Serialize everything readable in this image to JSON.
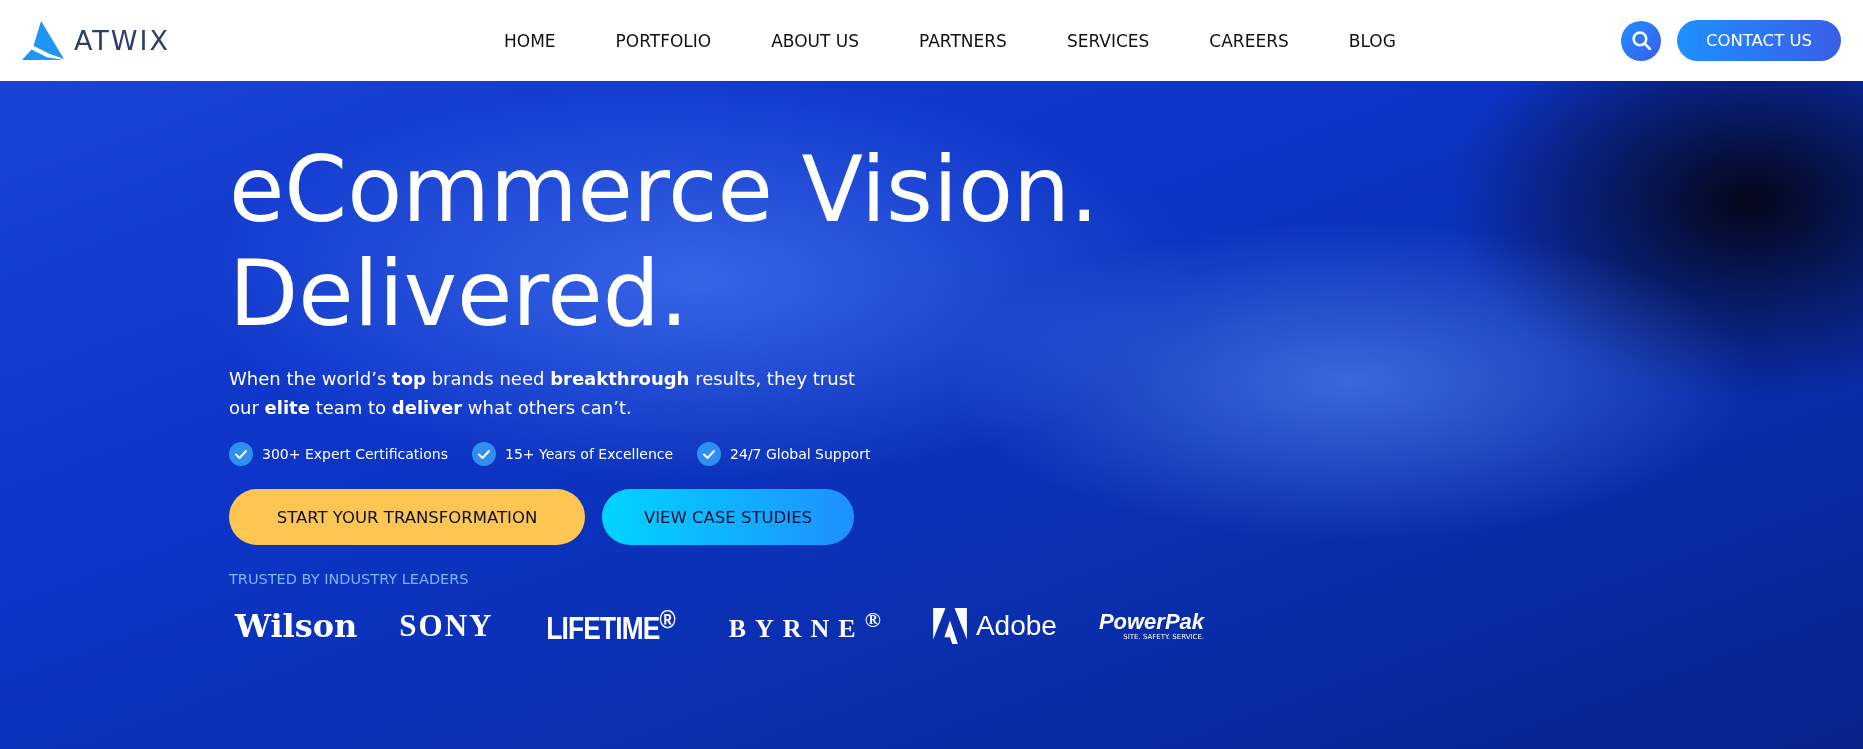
{
  "header": {
    "logo": "ATWIX",
    "nav": [
      {
        "label": "HOME"
      },
      {
        "label": "PORTFOLIO"
      },
      {
        "label": "ABOUT US"
      },
      {
        "label": "PARTNERS"
      },
      {
        "label": "SERVICES"
      },
      {
        "label": "CAREERS"
      },
      {
        "label": "BLOG"
      }
    ],
    "cta": "CONTACT US"
  },
  "hero": {
    "title_lines": [
      "eCommerce Vision.",
      "Delivered."
    ],
    "text": "When the world’s **top** brands need **breakthrough** results, they trust our **elite** team to **deliver** what others can’t.",
    "features": [
      "300+ Expert Certifications",
      "15+ Years of Excellence",
      "24/7 Global Support"
    ],
    "buttons": [
      {
        "label": "START YOUR TRANSFORMATION",
        "kind": "primary"
      },
      {
        "label": "VIEW CASE STUDIES",
        "kind": "secondary"
      }
    ],
    "trusted_label": "TRUSTED BY INDUSTRY LEADERS",
    "logos": [
      {
        "text": "Wilson",
        "kind": "slab"
      },
      {
        "text": "SONY",
        "kind": "serif"
      },
      {
        "text": "LIFETIME$^{®}$",
        "kind": "condensed"
      },
      {
        "text": "BYRNE$^{®}$",
        "kind": "spaced"
      },
      {
        "text": "Adobe",
        "kind": "adobe"
      },
      {
        "text": "PowerPak",
        "kind": "italic",
        "tagline": "SITE. SAFETY. SERVICE."
      }
    ]
  }
}
